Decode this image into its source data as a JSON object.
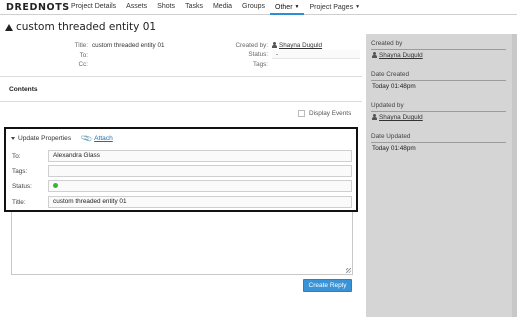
{
  "nav": {
    "brand": "DREDNOTS",
    "items": [
      "Project Details",
      "Assets",
      "Shots",
      "Tasks",
      "Media",
      "Groups",
      "Other",
      "Project Pages"
    ]
  },
  "entity": {
    "title": "custom threaded entity 01",
    "fields": {
      "title_label": "Title:",
      "title_value": "custom threaded entity 01",
      "to_label": "To:",
      "cc_label": "Cc:",
      "created_by_label": "Created by:",
      "created_by_value": "Shayna Duguld",
      "status_label": "Status:",
      "status_value": "-",
      "tags_label": "Tags:"
    }
  },
  "contents": {
    "label": "Contents",
    "display_events_label": "Display Events",
    "display_events_checked": false
  },
  "update_panel": {
    "heading": "Update Properties",
    "attach_label": "Attach",
    "rows": [
      {
        "label": "To:",
        "value": "Alexandra Glass"
      },
      {
        "label": "Tags:",
        "value": ""
      },
      {
        "label": "Status:",
        "value": ""
      },
      {
        "label": "Title:",
        "value": "custom threaded entity 01"
      }
    ],
    "status_color": "#33b833"
  },
  "reply": {
    "button_label": "Create Reply"
  },
  "sidebar": {
    "created_by_label": "Created by",
    "created_by_value": "Shayna Duguld",
    "date_created_label": "Date Created",
    "date_created_value": "Today 01:48pm",
    "updated_by_label": "Updated by",
    "updated_by_value": "Shayna Duguld",
    "date_updated_label": "Date Updated",
    "date_updated_value": "Today 01:48pm"
  },
  "colors": {
    "accent": "#2b8fd6",
    "button": "#3a93d6",
    "sidebar_bg": "#d5d5d5"
  }
}
